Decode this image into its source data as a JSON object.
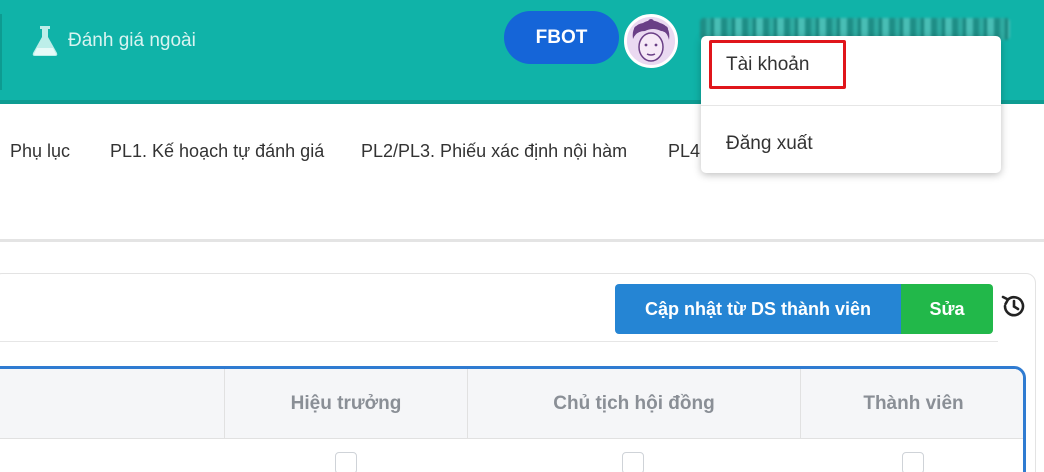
{
  "topbar": {
    "nav_label": "Đánh giá ngoài",
    "nav_icon": "flask-icon",
    "fbot_label": "FBOT",
    "accent": "#10b3a8"
  },
  "tabs": [
    {
      "label": "Phụ lục"
    },
    {
      "label": "PL1. Kế hoạch tự đánh giá"
    },
    {
      "label": "PL2/PL3. Phiếu xác định nội hàm"
    },
    {
      "label": "PL4."
    }
  ],
  "toolbar": {
    "update_label": "Cập nhật từ DS thành viên",
    "edit_label": "Sửa",
    "history_icon": "history-icon"
  },
  "table": {
    "headers": [
      "Hiệu trưởng",
      "Chủ tịch hội đồng",
      "Thành viên"
    ]
  },
  "dropdown": {
    "items": [
      {
        "label": "Tài khoản"
      },
      {
        "label": "Đăng xuất"
      }
    ],
    "highlight_color": "#e0151b"
  }
}
